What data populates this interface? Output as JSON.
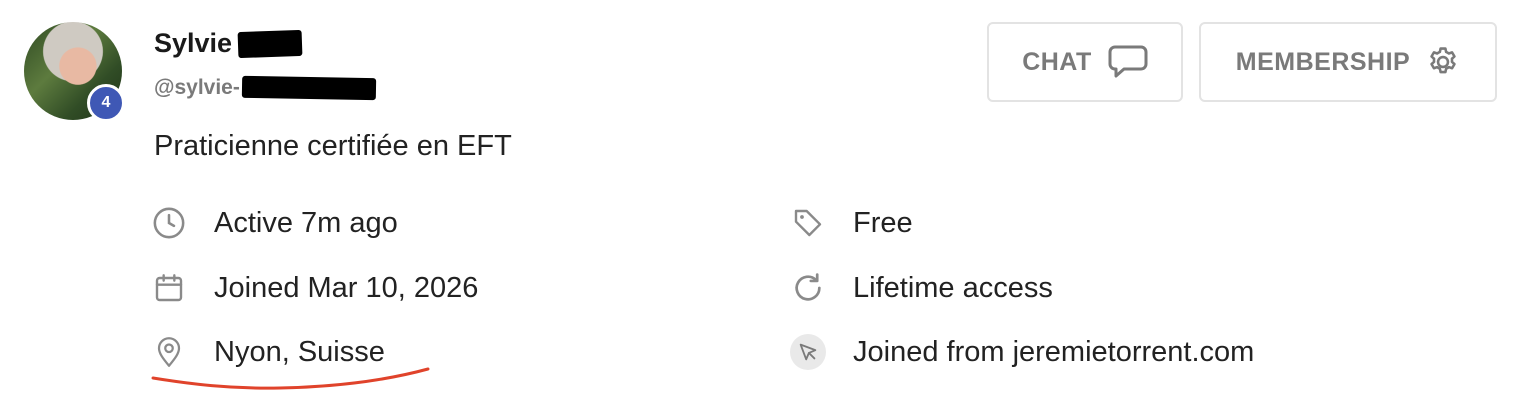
{
  "profile": {
    "first_name": "Sylvie",
    "handle_prefix": "@sylvie-",
    "level": "4",
    "bio": "Praticienne certifiée en EFT"
  },
  "buttons": {
    "chat": "CHAT",
    "membership": "MEMBERSHIP"
  },
  "details": {
    "activity": "Active 7m ago",
    "joined_date": "Joined Mar 10, 2026",
    "location": "Nyon, Suisse",
    "plan": "Free",
    "access": "Lifetime access",
    "referral": "Joined from jeremietorrent.com"
  },
  "icons": {
    "activity": "clock-icon",
    "joined_date": "calendar-icon",
    "location": "map-pin-icon",
    "plan": "tag-icon",
    "access": "refresh-icon",
    "referral": "cursor-pointer-icon",
    "chat": "chat-bubble-icon",
    "membership": "gear-icon"
  },
  "colors": {
    "level_badge": "#3f58b5",
    "muted_text": "#7a7a7a",
    "icon_gray": "#8a8a8a",
    "annotation_underline": "#e0432b"
  }
}
